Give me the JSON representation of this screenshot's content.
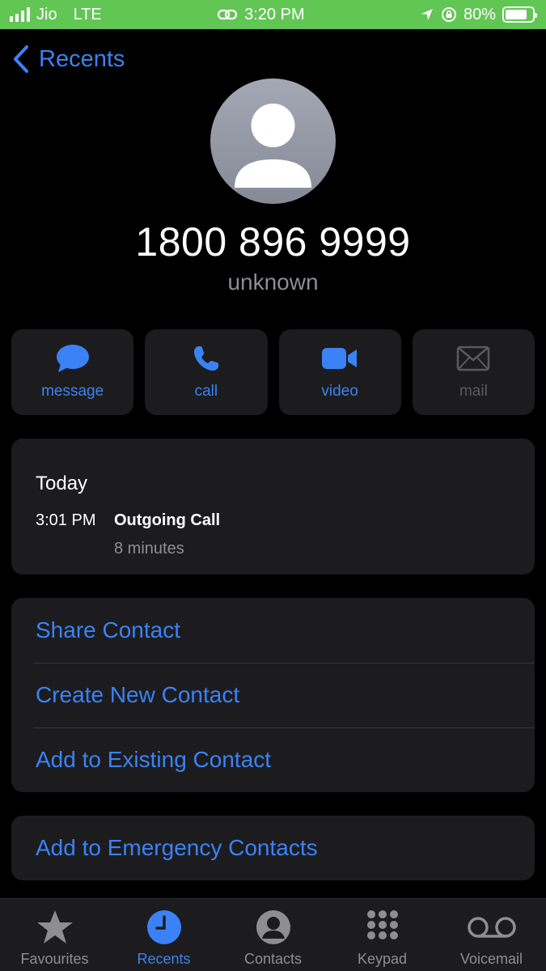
{
  "status_bar": {
    "carrier": "Jio",
    "network": "LTE",
    "time": "3:20 PM",
    "battery": "80%",
    "battery_level": 0.8
  },
  "nav": {
    "back_label": "Recents"
  },
  "contact": {
    "number": "1800 896 9999",
    "label": "unknown"
  },
  "actions": [
    {
      "label": "message",
      "icon": "message-icon",
      "enabled": true
    },
    {
      "label": "call",
      "icon": "phone-icon",
      "enabled": true
    },
    {
      "label": "video",
      "icon": "video-icon",
      "enabled": true
    },
    {
      "label": "mail",
      "icon": "mail-icon",
      "enabled": false
    }
  ],
  "history": {
    "day": "Today",
    "entries": [
      {
        "time": "3:01 PM",
        "type": "Outgoing Call",
        "duration": "8 minutes"
      }
    ]
  },
  "menu": {
    "items": [
      {
        "label": "Share Contact"
      },
      {
        "label": "Create New Contact"
      },
      {
        "label": "Add to Existing Contact"
      }
    ]
  },
  "emergency": {
    "label": "Add to Emergency Contacts"
  },
  "tabbar": {
    "tabs": [
      {
        "label": "Favourites",
        "icon": "star-icon"
      },
      {
        "label": "Recents",
        "icon": "clock-icon",
        "active": true
      },
      {
        "label": "Contacts",
        "icon": "person-circle-icon"
      },
      {
        "label": "Keypad",
        "icon": "keypad-icon"
      },
      {
        "label": "Voicemail",
        "icon": "voicemail-icon"
      }
    ]
  },
  "colors": {
    "accent": "#3b82f6",
    "status_bar": "#62c655",
    "card": "#1c1c1e",
    "secondary_text": "#8d8d93"
  }
}
